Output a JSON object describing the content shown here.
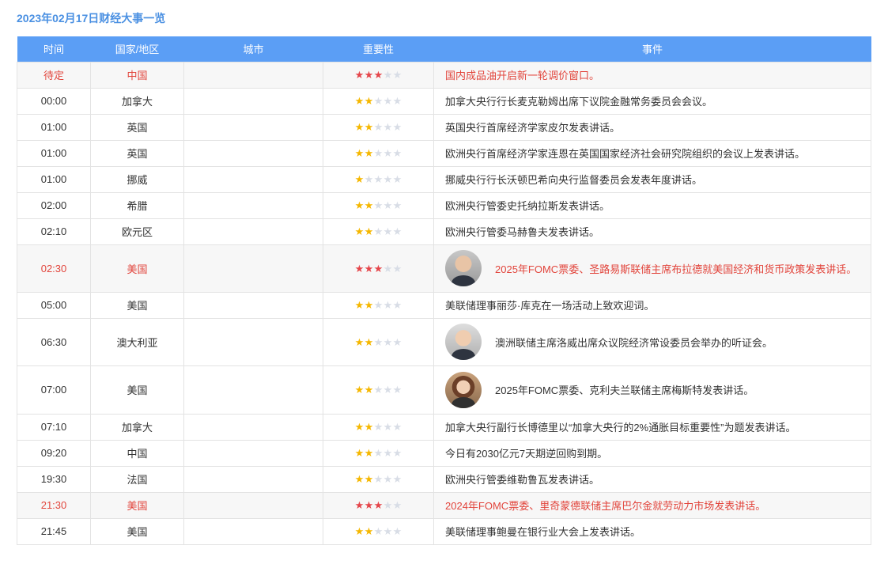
{
  "title": "2023年02月17日财经大事一览",
  "headers": {
    "time": "时间",
    "country": "国家/地区",
    "city": "城市",
    "importance": "重要性",
    "event": "事件"
  },
  "rows": [
    {
      "time": "待定",
      "country": "中国",
      "city": "",
      "importance": 3,
      "event": "国内成品油开启新一轮调价窗口。",
      "highlight": true,
      "avatar": ""
    },
    {
      "time": "00:00",
      "country": "加拿大",
      "city": "",
      "importance": 2,
      "event": "加拿大央行行长麦克勒姆出席下议院金融常务委员会会议。",
      "highlight": false,
      "avatar": ""
    },
    {
      "time": "01:00",
      "country": "英国",
      "city": "",
      "importance": 2,
      "event": "英国央行首席经济学家皮尔发表讲话。",
      "highlight": false,
      "avatar": ""
    },
    {
      "time": "01:00",
      "country": "英国",
      "city": "",
      "importance": 2,
      "event": "欧洲央行首席经济学家连恩在英国国家经济社会研究院组织的会议上发表讲话。",
      "highlight": false,
      "avatar": ""
    },
    {
      "time": "01:00",
      "country": "挪威",
      "city": "",
      "importance": 1,
      "event": "挪威央行行长沃顿巴希向央行监督委员会发表年度讲话。",
      "highlight": false,
      "avatar": ""
    },
    {
      "time": "02:00",
      "country": "希腊",
      "city": "",
      "importance": 2,
      "event": "欧洲央行管委史托纳拉斯发表讲话。",
      "highlight": false,
      "avatar": ""
    },
    {
      "time": "02:10",
      "country": "欧元区",
      "city": "",
      "importance": 2,
      "event": "欧洲央行管委马赫鲁夫发表讲话。",
      "highlight": false,
      "avatar": ""
    },
    {
      "time": "02:30",
      "country": "美国",
      "city": "",
      "importance": 3,
      "event": "2025年FOMC票委、圣路易斯联储主席布拉德就美国经济和货币政策发表讲话。",
      "highlight": true,
      "avatar": "a1"
    },
    {
      "time": "05:00",
      "country": "美国",
      "city": "",
      "importance": 2,
      "event": "美联储理事丽莎·库克在一场活动上致欢迎词。",
      "highlight": false,
      "avatar": ""
    },
    {
      "time": "06:30",
      "country": "澳大利亚",
      "city": "",
      "importance": 2,
      "event": "澳洲联储主席洛威出席众议院经济常设委员会举办的听证会。",
      "highlight": false,
      "avatar": "a2"
    },
    {
      "time": "07:00",
      "country": "美国",
      "city": "",
      "importance": 2,
      "event": "2025年FOMC票委、克利夫兰联储主席梅斯特发表讲话。",
      "highlight": false,
      "avatar": "a3"
    },
    {
      "time": "07:10",
      "country": "加拿大",
      "city": "",
      "importance": 2,
      "event": "加拿大央行副行长博德里以“加拿大央行的2%通胀目标重要性”为题发表讲话。",
      "highlight": false,
      "avatar": ""
    },
    {
      "time": "09:20",
      "country": "中国",
      "city": "",
      "importance": 2,
      "event": "今日有2030亿元7天期逆回购到期。",
      "highlight": false,
      "avatar": ""
    },
    {
      "time": "19:30",
      "country": "法国",
      "city": "",
      "importance": 2,
      "event": "欧洲央行管委维勒鲁瓦发表讲话。",
      "highlight": false,
      "avatar": ""
    },
    {
      "time": "21:30",
      "country": "美国",
      "city": "",
      "importance": 3,
      "event": "2024年FOMC票委、里奇蒙德联储主席巴尔金就劳动力市场发表讲话。",
      "highlight": true,
      "avatar": ""
    },
    {
      "time": "21:45",
      "country": "美国",
      "city": "",
      "importance": 2,
      "event": "美联储理事鲍曼在银行业大会上发表讲话。",
      "highlight": false,
      "avatar": ""
    }
  ],
  "colors": {
    "header_bg": "#5b9ef5",
    "title": "#4a90e2",
    "highlight_text": "#e2453c",
    "star_gold": "#f5b700",
    "star_red": "#e5454a",
    "star_empty": "#d8dde6"
  }
}
